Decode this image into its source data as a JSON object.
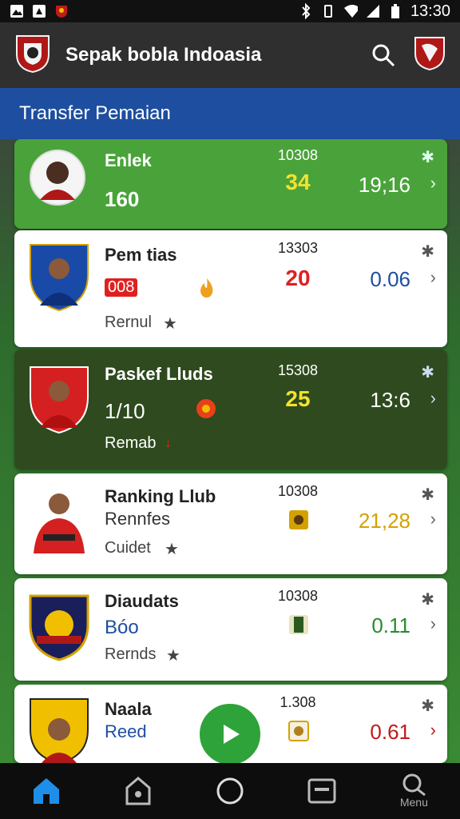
{
  "status": {
    "time": "13:30"
  },
  "app": {
    "title": "Sepak bobla Indoasia"
  },
  "section": {
    "title": "Transfer Pemaian"
  },
  "cards": [
    {
      "name": "Enlek",
      "sub": "160",
      "code": "10308",
      "mid": "34",
      "value": "19;16"
    },
    {
      "name": "Pem tias",
      "sub": "008",
      "small": "Rernul",
      "code": "13303",
      "mid": "20",
      "value": "0.06"
    },
    {
      "name": "Paskef Lluds",
      "sub": "1/10",
      "small": "Remab",
      "code": "15308",
      "mid": "25",
      "value": "13:6"
    },
    {
      "name": "Ranking Llub",
      "sub": "Rennfes",
      "small": "Cuidet",
      "code": "10308",
      "value": "21,28"
    },
    {
      "name": "Diaudats",
      "sub": "Bóo",
      "small": "Rernds",
      "code": "10308",
      "value": "0.11"
    },
    {
      "name": "Naala",
      "sub": "Reed",
      "code": "1.308",
      "value": "0.61"
    }
  ],
  "nav": {
    "menu_label": "Menu"
  },
  "colors": {
    "header": "#2f2f2f",
    "section": "#1e4ea0",
    "green_card": "#4aa33a",
    "dark_card": "#2e4a1e",
    "fab": "#2ea33a"
  }
}
